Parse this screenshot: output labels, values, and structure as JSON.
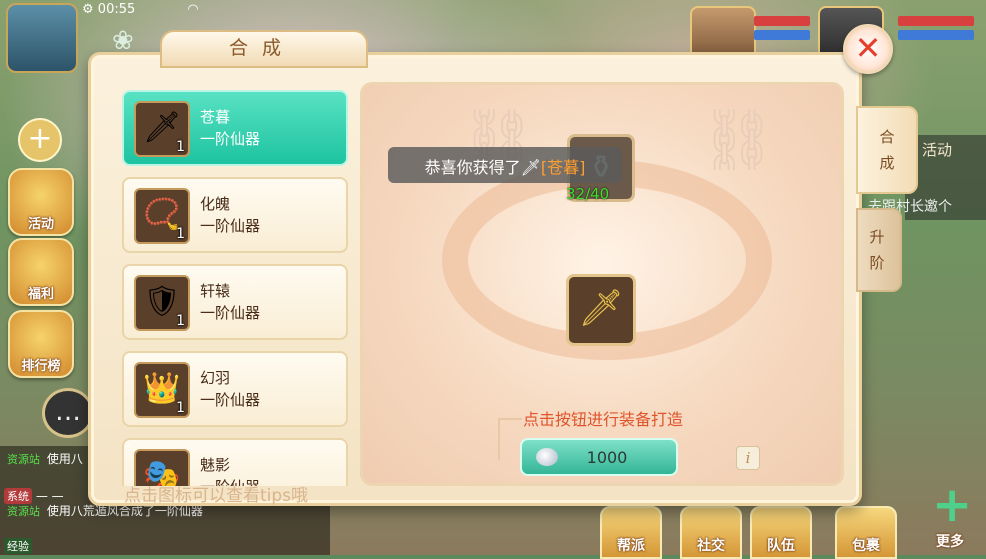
{
  "status": {
    "time": "00:55"
  },
  "hud_left": {
    "buttons": [
      {
        "label": "活动"
      },
      {
        "label": "福利"
      },
      {
        "label": "排行榜"
      }
    ]
  },
  "chat": {
    "lines": [
      {
        "tag": "资源站",
        "text": "使用八"
      },
      {
        "tag": "系统",
        "text": "— —"
      },
      {
        "tag": "资源站",
        "text": "使用八荒遁风合成了一阶仙器"
      }
    ],
    "footer": "经验"
  },
  "bottom_bar": {
    "buttons": [
      {
        "label": "帮派"
      },
      {
        "label": "社交"
      },
      {
        "label": "队伍"
      },
      {
        "label": "包裹"
      }
    ],
    "more_label": "更多"
  },
  "activity_panel": {
    "label": "活动",
    "text": "去跟村长邀个"
  },
  "dialog": {
    "title": "合成",
    "close_symbol": "✕",
    "items": [
      {
        "name": "苍暮",
        "grade": "一阶仙器",
        "count": "1",
        "glyph": "🗡",
        "selected": true
      },
      {
        "name": "化魄",
        "grade": "一阶仙器",
        "count": "1",
        "glyph": "📿",
        "selected": false
      },
      {
        "name": "轩辕",
        "grade": "一阶仙器",
        "count": "1",
        "glyph": "🛡",
        "selected": false
      },
      {
        "name": "幻羽",
        "grade": "一阶仙器",
        "count": "1",
        "glyph": "👑",
        "selected": false
      },
      {
        "name": "魅影",
        "grade": "一阶仙器",
        "count": "",
        "glyph": "🎭",
        "selected": false
      }
    ],
    "toast": {
      "prefix": "恭喜你获得了",
      "item": "[苍暮]"
    },
    "material": {
      "have": "32/40",
      "need": "/40"
    },
    "hint": "点击按钮进行装备打造",
    "craft_cost": "1000",
    "info_symbol": "i",
    "tips": "点击图标可以查看tips哦"
  },
  "side_tabs": [
    {
      "label": "合成"
    },
    {
      "label": "升阶"
    }
  ],
  "colors": {
    "selected_item": "#1ec3a0",
    "hint": "#e0542c",
    "toast_highlight": "#ff9f2e",
    "material_have": "#3ede2a"
  }
}
